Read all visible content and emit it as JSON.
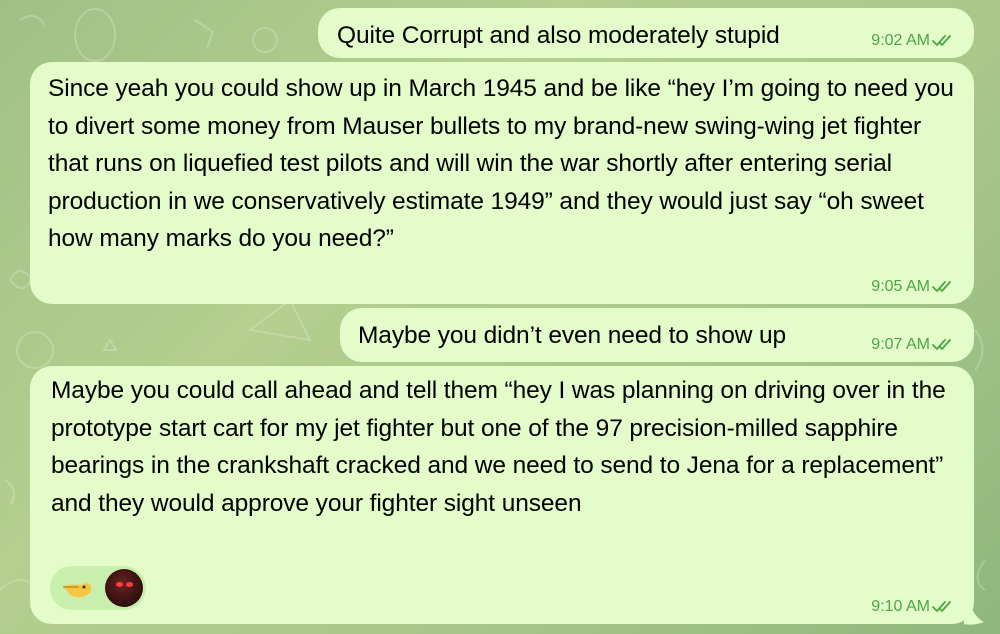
{
  "theme": {
    "bubble_color": "#e3fcc9",
    "time_color": "#4ea546",
    "background": "#a9c78a"
  },
  "messages": [
    {
      "text": "Quite Corrupt and also moderately stupid",
      "time": "9:02 AM",
      "read_icon": "double-check-icon"
    },
    {
      "text": "Since yeah you could show up in March 1945 and be like “hey I’m going to need you to divert some money from Mauser bullets to my brand-new swing-wing jet fighter that runs on liquefied test pilots and will win the war shortly after entering serial production in we conservatively estimate 1949” and they would just say “oh sweet how many marks do you need?”",
      "time": "9:05 AM",
      "read_icon": "double-check-icon"
    },
    {
      "text": "Maybe you didn’t even need to show up",
      "time": "9:07 AM",
      "read_icon": "double-check-icon"
    },
    {
      "text": "Maybe you could call ahead and tell them “hey I was planning on driving over in the prototype start cart for my jet fighter but one of the 97 precision-milled sapphire bearings in the crankshaft cracked and we need to send to Jena for a replacement” and they would approve your fighter sight unseen",
      "time": "9:10 AM",
      "read_icon": "double-check-icon",
      "reactions": [
        {
          "icon": "pointing-hand-emoji-icon"
        },
        {
          "icon": "user-avatar"
        }
      ]
    }
  ]
}
